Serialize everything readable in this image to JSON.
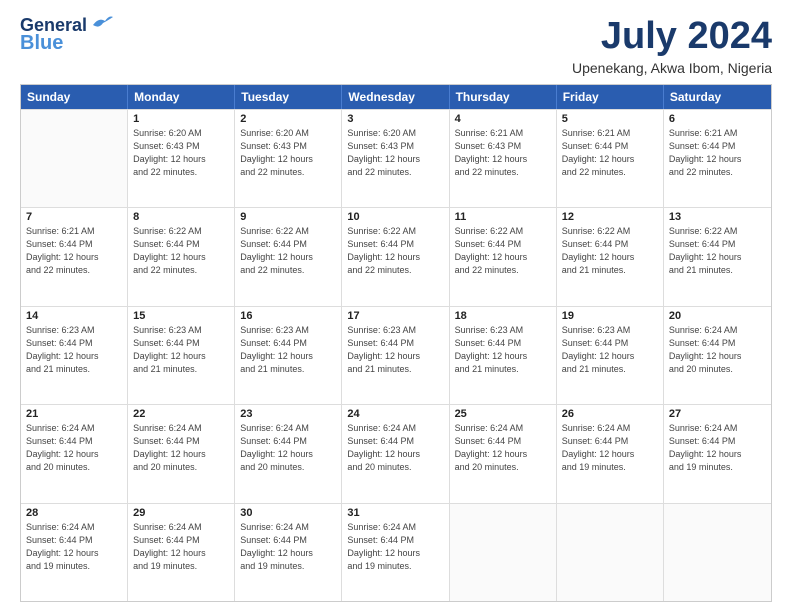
{
  "logo": {
    "line1": "General",
    "line2": "Blue"
  },
  "title": "July 2024",
  "subtitle": "Upenekang, Akwa Ibom, Nigeria",
  "calendar": {
    "headers": [
      "Sunday",
      "Monday",
      "Tuesday",
      "Wednesday",
      "Thursday",
      "Friday",
      "Saturday"
    ],
    "weeks": [
      [
        {
          "day": "",
          "info": ""
        },
        {
          "day": "1",
          "info": "Sunrise: 6:20 AM\nSunset: 6:43 PM\nDaylight: 12 hours\nand 22 minutes."
        },
        {
          "day": "2",
          "info": "Sunrise: 6:20 AM\nSunset: 6:43 PM\nDaylight: 12 hours\nand 22 minutes."
        },
        {
          "day": "3",
          "info": "Sunrise: 6:20 AM\nSunset: 6:43 PM\nDaylight: 12 hours\nand 22 minutes."
        },
        {
          "day": "4",
          "info": "Sunrise: 6:21 AM\nSunset: 6:43 PM\nDaylight: 12 hours\nand 22 minutes."
        },
        {
          "day": "5",
          "info": "Sunrise: 6:21 AM\nSunset: 6:44 PM\nDaylight: 12 hours\nand 22 minutes."
        },
        {
          "day": "6",
          "info": "Sunrise: 6:21 AM\nSunset: 6:44 PM\nDaylight: 12 hours\nand 22 minutes."
        }
      ],
      [
        {
          "day": "7",
          "info": "Sunrise: 6:21 AM\nSunset: 6:44 PM\nDaylight: 12 hours\nand 22 minutes."
        },
        {
          "day": "8",
          "info": "Sunrise: 6:22 AM\nSunset: 6:44 PM\nDaylight: 12 hours\nand 22 minutes."
        },
        {
          "day": "9",
          "info": "Sunrise: 6:22 AM\nSunset: 6:44 PM\nDaylight: 12 hours\nand 22 minutes."
        },
        {
          "day": "10",
          "info": "Sunrise: 6:22 AM\nSunset: 6:44 PM\nDaylight: 12 hours\nand 22 minutes."
        },
        {
          "day": "11",
          "info": "Sunrise: 6:22 AM\nSunset: 6:44 PM\nDaylight: 12 hours\nand 22 minutes."
        },
        {
          "day": "12",
          "info": "Sunrise: 6:22 AM\nSunset: 6:44 PM\nDaylight: 12 hours\nand 21 minutes."
        },
        {
          "day": "13",
          "info": "Sunrise: 6:22 AM\nSunset: 6:44 PM\nDaylight: 12 hours\nand 21 minutes."
        }
      ],
      [
        {
          "day": "14",
          "info": "Sunrise: 6:23 AM\nSunset: 6:44 PM\nDaylight: 12 hours\nand 21 minutes."
        },
        {
          "day": "15",
          "info": "Sunrise: 6:23 AM\nSunset: 6:44 PM\nDaylight: 12 hours\nand 21 minutes."
        },
        {
          "day": "16",
          "info": "Sunrise: 6:23 AM\nSunset: 6:44 PM\nDaylight: 12 hours\nand 21 minutes."
        },
        {
          "day": "17",
          "info": "Sunrise: 6:23 AM\nSunset: 6:44 PM\nDaylight: 12 hours\nand 21 minutes."
        },
        {
          "day": "18",
          "info": "Sunrise: 6:23 AM\nSunset: 6:44 PM\nDaylight: 12 hours\nand 21 minutes."
        },
        {
          "day": "19",
          "info": "Sunrise: 6:23 AM\nSunset: 6:44 PM\nDaylight: 12 hours\nand 21 minutes."
        },
        {
          "day": "20",
          "info": "Sunrise: 6:24 AM\nSunset: 6:44 PM\nDaylight: 12 hours\nand 20 minutes."
        }
      ],
      [
        {
          "day": "21",
          "info": "Sunrise: 6:24 AM\nSunset: 6:44 PM\nDaylight: 12 hours\nand 20 minutes."
        },
        {
          "day": "22",
          "info": "Sunrise: 6:24 AM\nSunset: 6:44 PM\nDaylight: 12 hours\nand 20 minutes."
        },
        {
          "day": "23",
          "info": "Sunrise: 6:24 AM\nSunset: 6:44 PM\nDaylight: 12 hours\nand 20 minutes."
        },
        {
          "day": "24",
          "info": "Sunrise: 6:24 AM\nSunset: 6:44 PM\nDaylight: 12 hours\nand 20 minutes."
        },
        {
          "day": "25",
          "info": "Sunrise: 6:24 AM\nSunset: 6:44 PM\nDaylight: 12 hours\nand 20 minutes."
        },
        {
          "day": "26",
          "info": "Sunrise: 6:24 AM\nSunset: 6:44 PM\nDaylight: 12 hours\nand 19 minutes."
        },
        {
          "day": "27",
          "info": "Sunrise: 6:24 AM\nSunset: 6:44 PM\nDaylight: 12 hours\nand 19 minutes."
        }
      ],
      [
        {
          "day": "28",
          "info": "Sunrise: 6:24 AM\nSunset: 6:44 PM\nDaylight: 12 hours\nand 19 minutes."
        },
        {
          "day": "29",
          "info": "Sunrise: 6:24 AM\nSunset: 6:44 PM\nDaylight: 12 hours\nand 19 minutes."
        },
        {
          "day": "30",
          "info": "Sunrise: 6:24 AM\nSunset: 6:44 PM\nDaylight: 12 hours\nand 19 minutes."
        },
        {
          "day": "31",
          "info": "Sunrise: 6:24 AM\nSunset: 6:44 PM\nDaylight: 12 hours\nand 19 minutes."
        },
        {
          "day": "",
          "info": ""
        },
        {
          "day": "",
          "info": ""
        },
        {
          "day": "",
          "info": ""
        }
      ]
    ]
  }
}
